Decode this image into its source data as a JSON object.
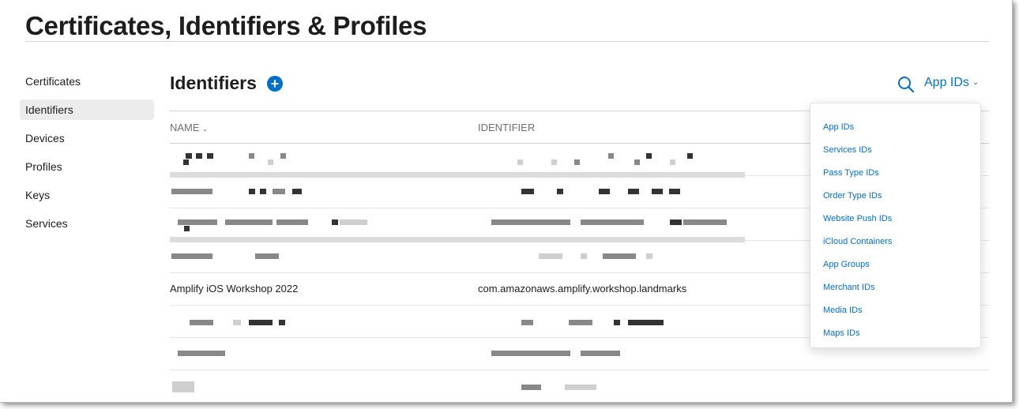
{
  "header": {
    "title": "Certificates, Identifiers & Profiles"
  },
  "sidebar": {
    "items": [
      {
        "label": "Certificates"
      },
      {
        "label": "Identifiers"
      },
      {
        "label": "Devices"
      },
      {
        "label": "Profiles"
      },
      {
        "label": "Keys"
      },
      {
        "label": "Services"
      }
    ],
    "active": "Identifiers"
  },
  "main": {
    "section_title": "Identifiers",
    "add_icon": "plus-circle-icon",
    "search_icon": "search-icon",
    "filter_label": "App IDs",
    "columns": {
      "name": "NAME",
      "identifier": "IDENTIFIER"
    },
    "visible_row": {
      "name": "Amplify iOS Workshop 2022",
      "identifier": "com.amazonaws.amplify.workshop.landmarks"
    }
  },
  "filter_menu": {
    "options": [
      "App IDs",
      "Services IDs",
      "Pass Type IDs",
      "Order Type IDs",
      "Website Push IDs",
      "iCloud Containers",
      "App Groups",
      "Merchant IDs",
      "Media IDs",
      "Maps IDs"
    ]
  },
  "colors": {
    "accent": "#0070c9",
    "text": "#1d1d1f",
    "muted": "#6e6e73"
  }
}
